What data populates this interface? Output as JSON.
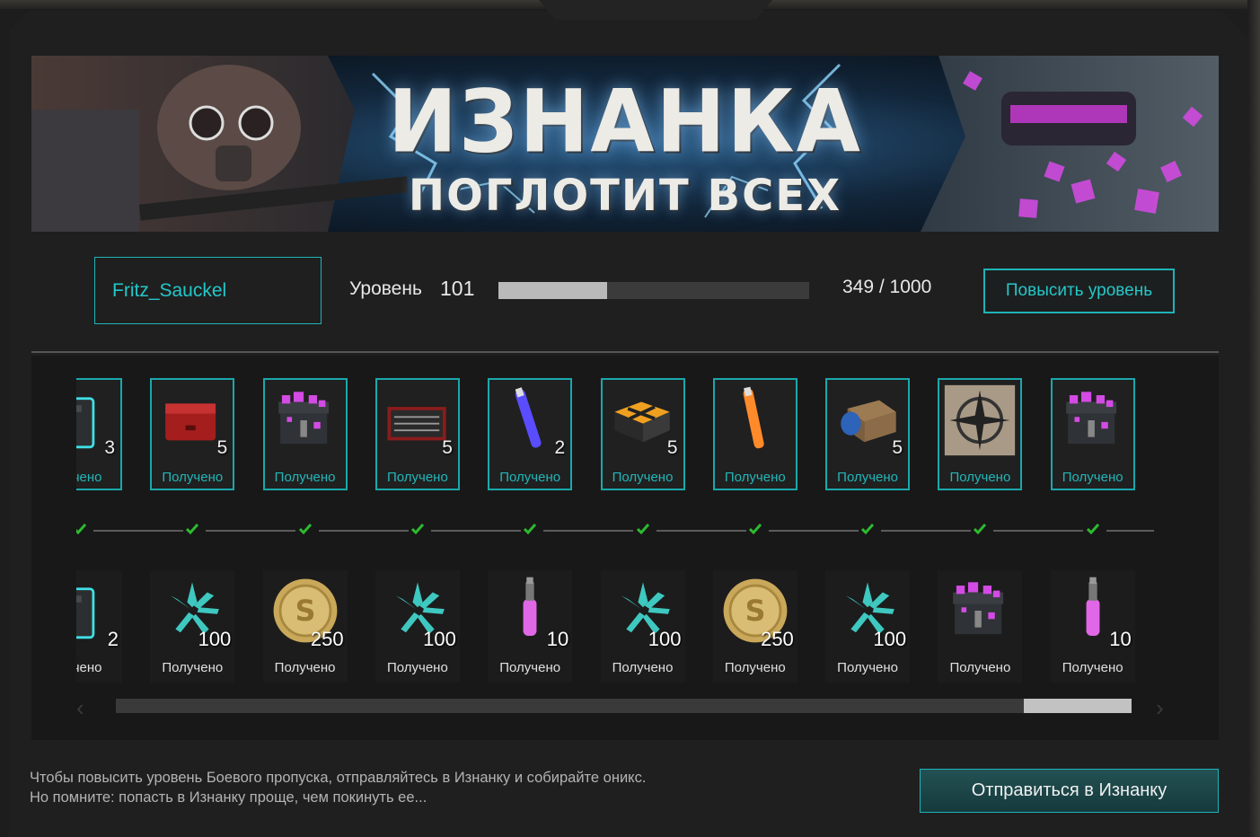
{
  "banner": {
    "title": "ИЗНАНКА",
    "subtitle": "ПОГЛОТИТ ВСЕХ"
  },
  "player": {
    "name": "Fritz_Sauckel",
    "level_label": "Уровень",
    "level": "101",
    "progress_text": "349 / 1000",
    "progress_fraction": 0.349,
    "level_up_button": "Повысить уровень"
  },
  "rewards_top": [
    {
      "icon": "weapon-case-icon",
      "qty": "3",
      "status": "лучено"
    },
    {
      "icon": "red-case-icon",
      "qty": "5",
      "status": "Получено"
    },
    {
      "icon": "onyx-chest-icon",
      "qty": "",
      "status": "Получено"
    },
    {
      "icon": "toolbox-icon",
      "qty": "5",
      "status": "Получено"
    },
    {
      "icon": "purple-glowstick-icon",
      "qty": "2",
      "status": "Получено"
    },
    {
      "icon": "supply-crate-icon",
      "qty": "5",
      "status": "Получено"
    },
    {
      "icon": "orange-glowstick-icon",
      "qty": "",
      "status": "Получено"
    },
    {
      "icon": "parcel-box-icon",
      "qty": "5",
      "status": "Получено"
    },
    {
      "icon": "compass-emblem-icon",
      "qty": "",
      "status": "Получено"
    },
    {
      "icon": "onyx-chest-icon",
      "qty": "",
      "status": "Получено"
    }
  ],
  "rewards_bottom": [
    {
      "icon": "weapon-case-icon",
      "qty": "2",
      "status": "лучено"
    },
    {
      "icon": "onyx-crystal-icon",
      "qty": "100",
      "status": "Получено"
    },
    {
      "icon": "coin-icon",
      "qty": "250",
      "status": "Получено"
    },
    {
      "icon": "onyx-crystal-icon",
      "qty": "100",
      "status": "Получено"
    },
    {
      "icon": "pink-stim-icon",
      "qty": "10",
      "status": "Получено"
    },
    {
      "icon": "onyx-crystal-icon",
      "qty": "100",
      "status": "Получено"
    },
    {
      "icon": "coin-icon",
      "qty": "250",
      "status": "Получено"
    },
    {
      "icon": "onyx-crystal-icon",
      "qty": "100",
      "status": "Получено"
    },
    {
      "icon": "onyx-chest-icon",
      "qty": "",
      "status": "Получено"
    },
    {
      "icon": "pink-stim-icon",
      "qty": "10",
      "status": "Получено"
    }
  ],
  "scroll": {
    "position_fraction": 0.89
  },
  "footer": {
    "hint_line1": "Чтобы повысить уровень Боевого пропуска, отправляйтесь в Изнанку и собирайте оникс.",
    "hint_line2": "Но помните: попасть в Изнанку проще, чем покинуть ее...",
    "go_button": "Отправиться в Изнанку"
  },
  "colors": {
    "accent": "#1fb3b8",
    "check": "#2dbb2d"
  }
}
